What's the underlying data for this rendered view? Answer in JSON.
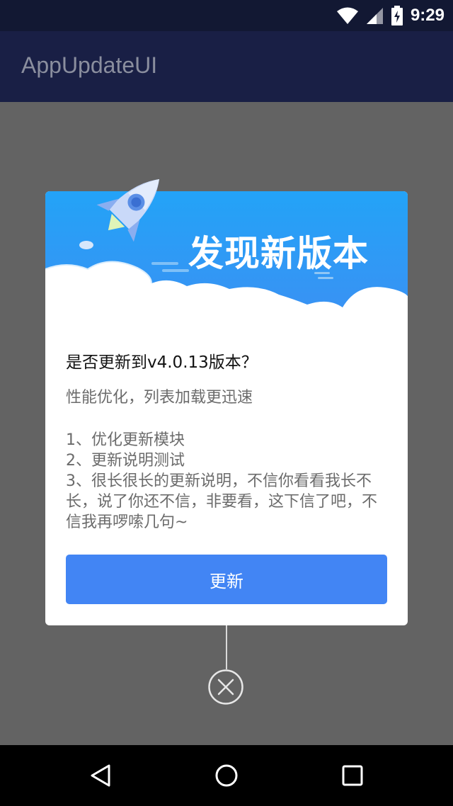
{
  "status_bar": {
    "time": "9:29",
    "icons": [
      "wifi-icon",
      "signal-icon",
      "battery-charging-icon"
    ]
  },
  "app_bar": {
    "title": "AppUpdateUI"
  },
  "dialog": {
    "headline": "发现新版本",
    "question": "是否更新到v4.0.13版本？",
    "summary": "性能优化，列表加载更迅速",
    "notes": [
      "1、优化更新模块",
      "2、更新说明测试",
      "3、很长很长的更新说明，不信你看看我长不长，说了你还不信，非要看，这下信了吧，不信我再啰嗦几句~"
    ],
    "update_button": "更新",
    "close_icon": "close-circle-icon"
  },
  "colors": {
    "header_top": "#23a3f7",
    "header_bottom": "#3e8ef3",
    "button": "#4285f4",
    "status_bar": "#121833",
    "app_bar": "#191f45"
  },
  "nav_bar": {
    "icons": [
      "back-icon",
      "home-icon",
      "recents-icon"
    ]
  }
}
